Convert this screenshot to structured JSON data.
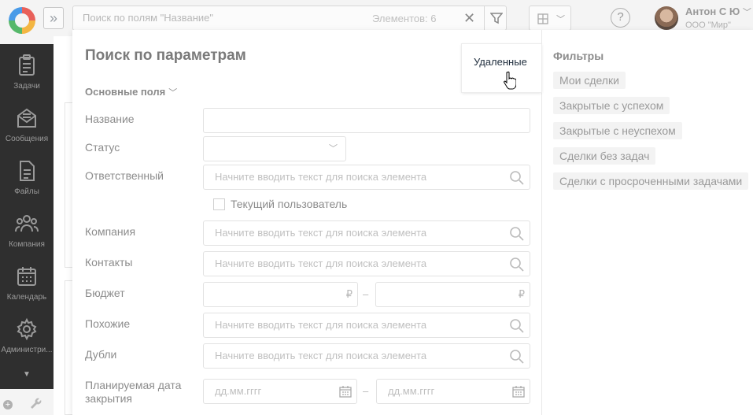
{
  "search": {
    "placeholder": "Поиск по полям \"Название\"",
    "elements_count": "Элементов: 6"
  },
  "user": {
    "name": "Антон С Ю",
    "company": "ООО \"Мир\""
  },
  "sidebar": {
    "items": [
      {
        "label": "Задачи",
        "icon": "tasks-icon"
      },
      {
        "label": "Сообщения",
        "icon": "messages-icon"
      },
      {
        "label": "Файлы",
        "icon": "files-icon"
      },
      {
        "label": "Компания",
        "icon": "company-icon"
      },
      {
        "label": "Календарь",
        "icon": "calendar-icon"
      },
      {
        "label": "Администри...",
        "icon": "settings-icon"
      }
    ]
  },
  "popup": {
    "title": "Поиск по параметрам",
    "deleted_link": "Удаленные",
    "section_label": "Основные поля",
    "fields": {
      "name": "Название",
      "status": "Статус",
      "responsible": "Ответственный",
      "current_user": "Текущий пользователь",
      "company": "Компания",
      "contacts": "Контакты",
      "budget": "Бюджет",
      "similar": "Похожие",
      "duplicates": "Дубли",
      "planned_close_line1": "Планируемая дата",
      "planned_close_line2": "закрытия"
    },
    "element_search_placeholder": "Начните вводить текст для поиска элемента",
    "currency": "₽",
    "range_dash": "–",
    "date_placeholder": "дд.мм.гггг",
    "filters_title": "Фильтры",
    "filters": [
      "Мои сделки",
      "Закрытые с успехом",
      "Закрытые с неуспехом",
      "Сделки без задач",
      "Сделки с просроченными задачами"
    ]
  },
  "colors": {
    "sidebar_bg": "#2f2f2f",
    "link": "#1f2d3d"
  }
}
